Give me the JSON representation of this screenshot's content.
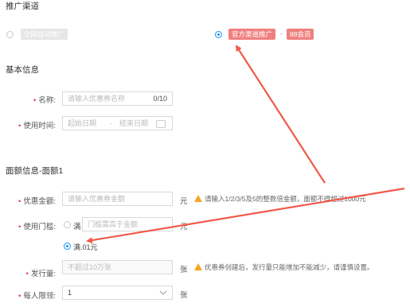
{
  "channel": {
    "title": "推广渠道",
    "option1": "全网自动推广",
    "option2_tag1": "官方渠道推广",
    "option2_sep": "-",
    "option2_tag2": "88会员"
  },
  "basic": {
    "title": "基本信息",
    "name_label": "名称:",
    "name_placeholder": "请输入优惠券名称",
    "name_counter": "0/10",
    "time_label": "使用时间:",
    "start_placeholder": "起始日期",
    "time_sep": "-",
    "end_placeholder": "结束日期"
  },
  "amount": {
    "title": "面额信息-面额1",
    "coupon_label": "优惠金额:",
    "coupon_placeholder": "请输入优惠券金额",
    "coupon_unit": "元",
    "coupon_hint": "请输入1/2/3/5及5的整数倍金额，面额不得超过1000元",
    "threshold_label": "使用门槛:",
    "threshold_prefix": "满",
    "threshold_placeholder": "门槛需高于金额",
    "threshold_unit": "元",
    "threshold_option2": "满.01元",
    "issue_label": "发行量:",
    "issue_placeholder": "不超过10万张",
    "issue_unit": "张",
    "issue_hint": "优惠券创建后，发行量只能增加不能减少，请谨慎设置。",
    "limit_label": "每人限领:",
    "limit_value": "1",
    "limit_unit": "张"
  },
  "colors": {
    "accent": "#1890ff",
    "tag_red": "#f08080",
    "arrow": "#f05a4a",
    "warning": "#f5a623"
  }
}
